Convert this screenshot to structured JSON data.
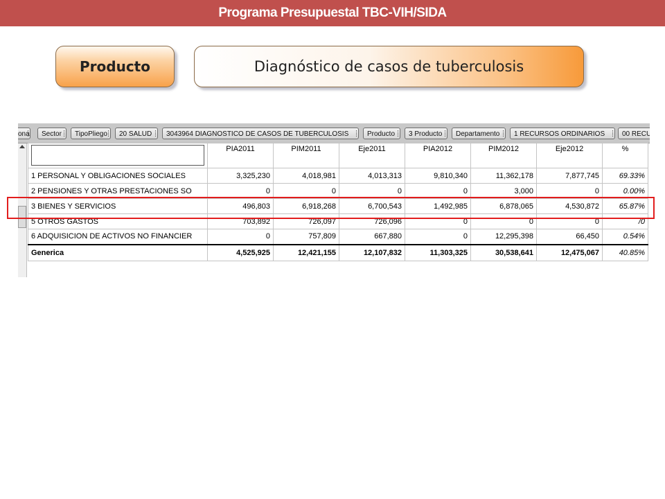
{
  "header": {
    "title": "Programa Presupuestal  TBC-VIH/SIDA"
  },
  "pills": {
    "left_label": "Producto",
    "right_label": "Diagnóstico de casos de tuberculosis"
  },
  "tabs": [
    "onal",
    "Sector",
    "TipoPliego",
    "20 SALUD",
    "3043964 DIAGNOSTICO DE CASOS DE TUBERCULOSIS",
    "Producto",
    "3 Producto",
    "Departamento",
    "1 RECURSOS ORDINARIOS",
    "00 RECU"
  ],
  "table": {
    "columns": [
      "PIA2011",
      "PIM2011",
      "Eje2011",
      "PIA2012",
      "PIM2012",
      "Eje2012",
      "%"
    ],
    "rows": [
      {
        "label": "1 PERSONAL Y OBLIGACIONES SOCIALES",
        "values": [
          "3,325,230",
          "4,018,981",
          "4,013,313",
          "9,810,340",
          "11,362,178",
          "7,877,745"
        ],
        "pct": "69.33%"
      },
      {
        "label": "2 PENSIONES Y OTRAS PRESTACIONES SO",
        "values": [
          "0",
          "0",
          "0",
          "0",
          "3,000",
          "0"
        ],
        "pct": "0.00%"
      },
      {
        "label": "3 BIENES Y SERVICIOS",
        "values": [
          "496,803",
          "6,918,268",
          "6,700,543",
          "1,492,985",
          "6,878,065",
          "4,530,872"
        ],
        "pct": "65.87%"
      },
      {
        "label": "5 OTROS GASTOS",
        "values": [
          "703,892",
          "726,097",
          "726,096",
          "0",
          "0",
          "0"
        ],
        "pct": "/0"
      },
      {
        "label": "6 ADQUISICION DE ACTIVOS NO FINANCIER",
        "values": [
          "0",
          "757,809",
          "667,880",
          "0",
          "12,295,398",
          "66,450"
        ],
        "pct": "0.54%"
      }
    ],
    "total": {
      "label": "Generica",
      "values": [
        "4,525,925",
        "12,421,155",
        "12,107,832",
        "11,303,325",
        "30,538,641",
        "12,475,067"
      ],
      "pct": "40.85%"
    }
  },
  "colors": {
    "banner": "#c0504d",
    "pill_orange": "#f79a3a",
    "highlight": "#e21d1d"
  }
}
